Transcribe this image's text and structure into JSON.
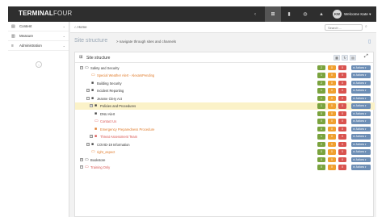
{
  "app": {
    "logo_a": "TERMINAL",
    "logo_b": "FOUR"
  },
  "topbar": {
    "icons": [
      "chevron-icon",
      "sitemap-icon",
      "bookmark-icon",
      "globe-icon",
      "graduation-icon"
    ],
    "user_initials": "KW",
    "user_label": "Welcome Kate ▾"
  },
  "sidebar": {
    "items": [
      {
        "label": "Content",
        "icon": "document-icon"
      },
      {
        "label": "Measure",
        "icon": "chart-icon"
      },
      {
        "label": "Administration",
        "icon": "sliders-icon"
      }
    ]
  },
  "breadcrumb": {
    "home": "⌂ Home"
  },
  "search": {
    "placeholder": "Search ..."
  },
  "page": {
    "title": "Site structure",
    "subtitle": "> navigate through sites and channels"
  },
  "panel": {
    "title": "Site structure"
  },
  "tree": [
    {
      "label": "Safety and Security",
      "style": "dark",
      "counts": [
        "2",
        "0",
        "0"
      ],
      "colors": [
        "green",
        "orange",
        "red"
      ]
    },
    {
      "label": "Special Weather Alert - AlexaIsPending",
      "style": "orange",
      "counts": [
        "1",
        "0",
        "0"
      ],
      "colors": [
        "green",
        "orange",
        "red"
      ]
    },
    {
      "label": "Building Security",
      "style": "dark",
      "counts": [
        "2",
        "0",
        "0"
      ],
      "colors": [
        "green",
        "orange",
        "red"
      ]
    },
    {
      "label": "Incident Reporting",
      "style": "dark",
      "counts": [
        "1",
        "0",
        "0"
      ],
      "colors": [
        "green",
        "orange",
        "red"
      ]
    },
    {
      "label": "Jeanne Clery Act",
      "style": "dark",
      "counts": [
        "1",
        "0",
        "0"
      ],
      "colors": [
        "green",
        "orange",
        "red"
      ]
    },
    {
      "label": "Policies and Procedures",
      "style": "dark",
      "counts": [
        "1",
        "0",
        "0"
      ],
      "colors": [
        "green",
        "orange",
        "red"
      ]
    },
    {
      "label": "DNU Alert",
      "style": "dark",
      "counts": [
        "0",
        "0",
        "0"
      ],
      "colors": [
        "green",
        "orange",
        "red"
      ]
    },
    {
      "label": "Contact Us",
      "style": "red",
      "counts": [
        "0",
        "0",
        "0"
      ],
      "colors": [
        "green",
        "orange",
        "red"
      ]
    },
    {
      "label": "Emergency Preparedness Procedure",
      "style": "orange",
      "counts": [
        "0",
        "0",
        "0"
      ],
      "colors": [
        "green",
        "orange",
        "red"
      ]
    },
    {
      "label": "Threat Assessment Team",
      "style": "red",
      "counts": [
        "1",
        "0",
        "0"
      ],
      "colors": [
        "green",
        "orange",
        "red"
      ]
    },
    {
      "label": "COVID-19 Information",
      "style": "dark",
      "counts": [
        "2",
        "0",
        "0"
      ],
      "colors": [
        "green",
        "orange",
        "red"
      ]
    },
    {
      "label": "right_aspect",
      "style": "orange",
      "counts": [
        "0",
        "0",
        "0"
      ],
      "colors": [
        "green",
        "orange",
        "red"
      ]
    },
    {
      "label": "Bookstore",
      "style": "dark",
      "counts": [
        "0",
        "0",
        "0"
      ],
      "colors": [
        "green",
        "orange",
        "red"
      ]
    },
    {
      "label": "Training Only",
      "style": "red",
      "counts": [
        "0",
        "0",
        "0"
      ],
      "colors": [
        "green",
        "orange",
        "red"
      ]
    }
  ],
  "actions_label": "⚙ Actions ▾",
  "colors": {
    "green": "#7aa33e",
    "orange": "#f0a030",
    "red": "#d9534f",
    "highlight": "#fbf2c8",
    "topbar": "#2e2e2e"
  }
}
